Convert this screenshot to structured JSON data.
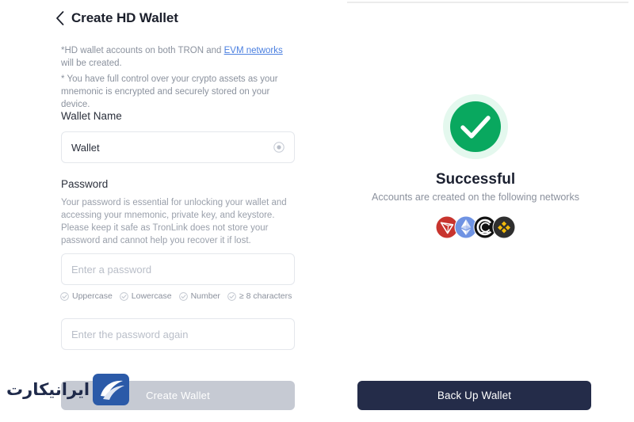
{
  "left": {
    "header": {
      "back_icon": "chevron-left-icon",
      "title": "Create HD Wallet"
    },
    "notes": {
      "note_1_before": "*HD wallet accounts on both TRON and ",
      "note_1_link": "EVM networks",
      "note_1_after": " will be created.",
      "note_2": "* You have full control over your crypto assets as your mnemonic is encrypted and securely stored on your device."
    },
    "wallet_name": {
      "label": "Wallet Name",
      "value": "Wallet",
      "placeholder": "Wallet Name",
      "clear_icon": "clear-circle-icon"
    },
    "password": {
      "label": "Password",
      "hint": "Your password is essential for unlocking your wallet and accessing your mnemonic, private key, and keystore. Please keep it safe as TronLink does not store your password and cannot help you recover it if lost.",
      "placeholder": "Enter a password",
      "value": "",
      "confirm_placeholder": "Enter the password again",
      "confirm_value": "",
      "rules": [
        {
          "label": "Uppercase",
          "satisfied": false
        },
        {
          "label": "Lowercase",
          "satisfied": false
        },
        {
          "label": "Number",
          "satisfied": false
        },
        {
          "label": "≥ 8 characters",
          "satisfied": false
        }
      ]
    },
    "create_button": {
      "label": "Create Wallet",
      "enabled": false,
      "color": "#c6cad3"
    },
    "watermark": {
      "text": "ایرانیکارت",
      "logo_icon": "iranicart-logo-icon",
      "color": "#1f2a4a"
    }
  },
  "right": {
    "success_icon": "green-check-circle-icon",
    "success_color": "#08a663",
    "title": "Successful",
    "subtitle": "Accounts are created on the following networks",
    "networks": [
      {
        "name": "tron-network-icon",
        "label": "TRON",
        "color": "#c93434"
      },
      {
        "name": "ethereum-network-icon",
        "label": "Ethereum",
        "color": "#6c8fe0"
      },
      {
        "name": "cronos-network-icon",
        "label": "Cronos",
        "color": "#111111"
      },
      {
        "name": "bnb-network-icon",
        "label": "BNB Chain",
        "color": "#2b2b2b"
      }
    ],
    "backup_button": {
      "label": "Back Up Wallet",
      "color": "#242c49"
    }
  }
}
